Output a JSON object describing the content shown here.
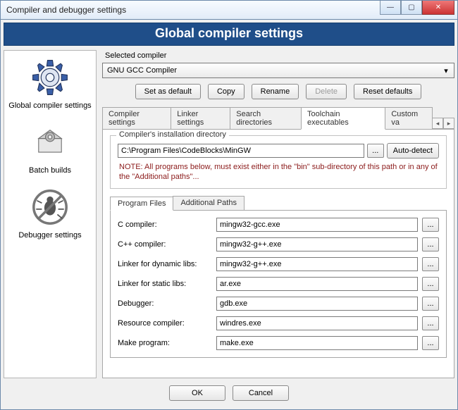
{
  "window": {
    "title": "Compiler and debugger settings"
  },
  "banner": "Global compiler settings",
  "sidebar": {
    "items": [
      {
        "label": "Global compiler settings"
      },
      {
        "label": "Batch builds"
      },
      {
        "label": "Debugger settings"
      }
    ]
  },
  "compiler": {
    "section_label": "Selected compiler",
    "selected": "GNU GCC Compiler",
    "buttons": {
      "set_default": "Set as default",
      "copy": "Copy",
      "rename": "Rename",
      "delete": "Delete",
      "reset": "Reset defaults"
    }
  },
  "tabs": {
    "main": [
      {
        "label": "Compiler settings"
      },
      {
        "label": "Linker settings"
      },
      {
        "label": "Search directories"
      },
      {
        "label": "Toolchain executables",
        "active": true
      },
      {
        "label": "Custom va"
      }
    ]
  },
  "install_dir": {
    "legend": "Compiler's installation directory",
    "path": "C:\\Program Files\\CodeBlocks\\MinGW",
    "browse": "...",
    "autodetect": "Auto-detect",
    "note": "NOTE: All programs below, must exist either in the \"bin\" sub-directory of this path or in any of the \"Additional paths\"..."
  },
  "prog_tabs": {
    "files": "Program Files",
    "paths": "Additional Paths"
  },
  "programs": {
    "c_compiler": {
      "label": "C compiler:",
      "value": "mingw32-gcc.exe"
    },
    "cpp_compiler": {
      "label": "C++ compiler:",
      "value": "mingw32-g++.exe"
    },
    "linker_dynamic": {
      "label": "Linker for dynamic libs:",
      "value": "mingw32-g++.exe"
    },
    "linker_static": {
      "label": "Linker for static libs:",
      "value": "ar.exe"
    },
    "debugger": {
      "label": "Debugger:",
      "value": "gdb.exe"
    },
    "resource": {
      "label": "Resource compiler:",
      "value": "windres.exe"
    },
    "make": {
      "label": "Make program:",
      "value": "make.exe"
    }
  },
  "browse_btn": "...",
  "footer": {
    "ok": "OK",
    "cancel": "Cancel"
  }
}
